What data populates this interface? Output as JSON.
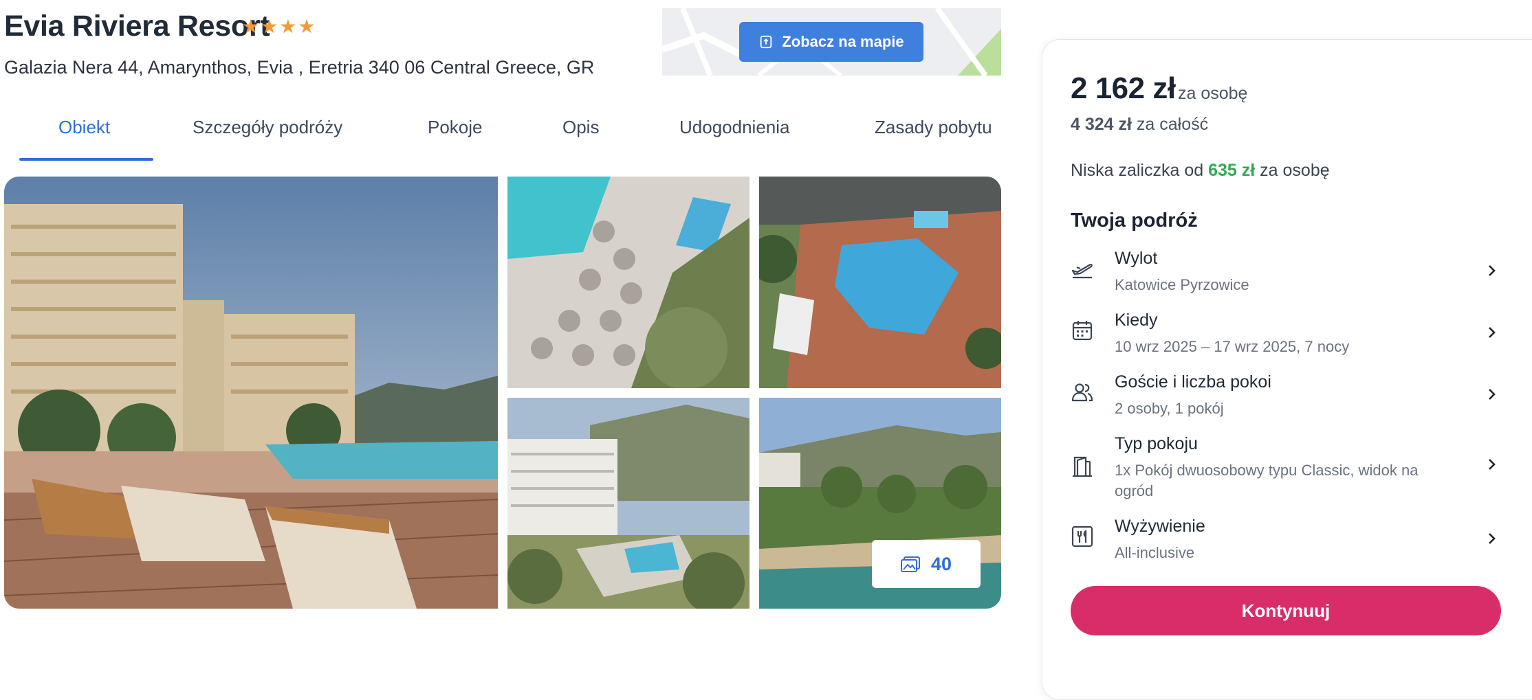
{
  "hotel": {
    "name": "Evia Riviera Resort",
    "stars": [
      "★",
      "★",
      "★",
      "★"
    ],
    "address": "Galazia Nera 44, Amarynthos, Evia , Eretria 340 06 Central Greece, GR"
  },
  "map": {
    "button_label": "Zobacz na mapie",
    "icon": "map-pin-icon"
  },
  "tabs": [
    {
      "label": "Obiekt"
    },
    {
      "label": "Szczegóły podróży"
    },
    {
      "label": "Pokoje"
    },
    {
      "label": "Opis"
    },
    {
      "label": "Udogodnienia"
    },
    {
      "label": "Zasady pobytu"
    }
  ],
  "gallery": {
    "photo_count": "40"
  },
  "pricing": {
    "per_person": "2 162 zł",
    "per_person_suffix": "za osobę",
    "total": "4 324 zł",
    "total_suffix": "za całość",
    "deposit_prefix": "Niska zaliczka od",
    "deposit_amount": "635 zł",
    "deposit_suffix": "za osobę"
  },
  "trip": {
    "title": "Twoja podróż",
    "rows": [
      {
        "label": "Wylot",
        "value": "Katowice Pyrzowice",
        "icon": "plane-departure-icon"
      },
      {
        "label": "Kiedy",
        "value": "10 wrz 2025 – 17 wrz 2025, 7 nocy",
        "icon": "calendar-icon"
      },
      {
        "label": "Goście i liczba pokoi",
        "value": "2 osoby, 1 pokój",
        "icon": "guests-icon"
      },
      {
        "label": "Typ pokoju",
        "value": "1x Pokój dwuosobowy typu Classic, widok na ogród",
        "icon": "door-icon"
      },
      {
        "label": "Wyżywienie",
        "value": "All-inclusive",
        "icon": "cutlery-icon"
      }
    ]
  },
  "actions": {
    "continue_label": "Kontynuuj"
  },
  "colors": {
    "accent_blue": "#2f6fd6",
    "cta_pink": "#d92d6a",
    "deposit_green": "#33a853",
    "star_orange": "#f29b38"
  }
}
